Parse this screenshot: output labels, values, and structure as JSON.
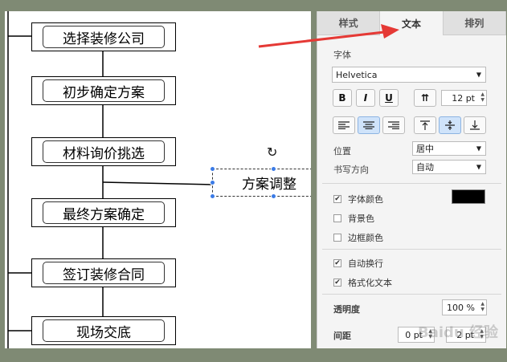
{
  "canvas": {
    "nodes": [
      "选择装修公司",
      "初步确定方案",
      "材料询价挑选",
      "最终方案确定",
      "签订装修合同",
      "现场交底"
    ],
    "selected_node": "方案调整"
  },
  "panel": {
    "tabs": [
      {
        "label": "样式",
        "active": false
      },
      {
        "label": "文本",
        "active": true
      },
      {
        "label": "排列",
        "active": false
      }
    ],
    "font_section_label": "字体",
    "font_family": "Helvetica",
    "bold_label": "B",
    "italic_label": "I",
    "underline_label": "U",
    "vertical_text_label": "⇈",
    "font_size": "12 pt",
    "position_label": "位置",
    "position_value": "居中",
    "writing_direction_label": "书写方向",
    "writing_direction_value": "自动",
    "font_color_label": "字体颜色",
    "font_color_checked": true,
    "font_color": "#000000",
    "background_color_label": "背景色",
    "background_color_checked": false,
    "border_color_label": "边框颜色",
    "border_color_checked": false,
    "auto_wrap_label": "自动换行",
    "auto_wrap_checked": true,
    "formatted_text_label": "格式化文本",
    "formatted_text_checked": true,
    "opacity_label": "透明度",
    "opacity_value": "100 %",
    "spacing_label": "间距",
    "spacing_top": "0 pt",
    "spacing_right": "2 pt"
  },
  "watermark_text": "Baidu 经验",
  "colors": {
    "accent_arrow": "#e53935",
    "selection_handle": "#3b7be6",
    "background": "#7f8a74"
  }
}
